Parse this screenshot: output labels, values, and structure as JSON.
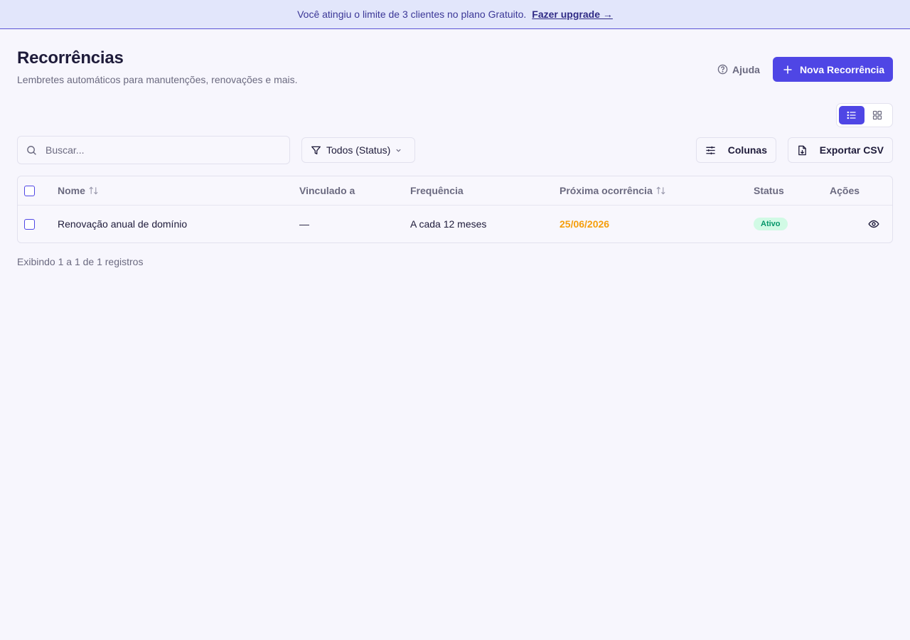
{
  "banner": {
    "message": "Você atingiu o limite de 3 clientes no plano Gratuito.",
    "link_label": "Fazer upgrade →"
  },
  "header": {
    "title": "Recorrências",
    "subtitle": "Lembretes automáticos para manutenções, renovações e mais.",
    "help_label": "Ajuda",
    "new_button_label": "Nova Recorrência"
  },
  "view_toggle": {
    "active": "list",
    "options": [
      "list",
      "grid"
    ]
  },
  "toolbar": {
    "search_placeholder": "Buscar...",
    "search_value": "",
    "filter_label": "Todos (Status)",
    "columns_label": "Colunas",
    "export_label": "Exportar CSV"
  },
  "table": {
    "columns": [
      "Nome",
      "Vinculado a",
      "Frequência",
      "Próxima ocorrência",
      "Status",
      "Ações"
    ],
    "rows": [
      {
        "nome": "Renovação anual de domínio",
        "vinculado": "—",
        "frequencia": "A cada 12 meses",
        "proxima": "25/06/2026",
        "status": "Ativo"
      }
    ]
  },
  "footer": {
    "summary": "Exibindo 1 a 1 de 1 registros"
  },
  "colors": {
    "accent": "#4f46e5",
    "date_warning": "#f59e0b",
    "status_active_bg": "#d1fae5",
    "status_active_fg": "#059669"
  },
  "icons": [
    "help-circle-icon",
    "plus-icon",
    "list-icon",
    "grid-icon",
    "search-icon",
    "filter-icon",
    "chevron-down-icon",
    "sliders-icon",
    "file-download-icon",
    "sort-icon",
    "eye-icon"
  ]
}
